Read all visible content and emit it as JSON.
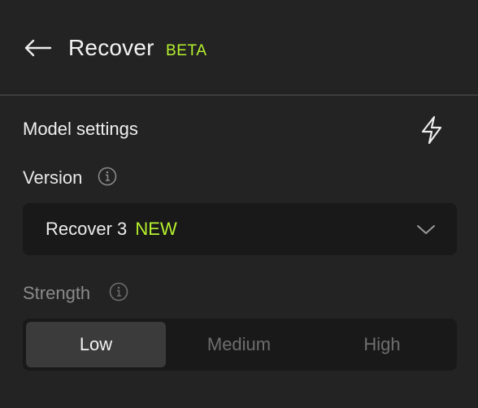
{
  "header": {
    "title": "Recover",
    "badge": "BETA",
    "icons": {
      "back": "arrow-left-icon"
    }
  },
  "model_settings": {
    "title": "Model settings",
    "icons": {
      "action": "lightning-bolt-icon"
    },
    "version": {
      "label": "Version",
      "info_icon": "info-icon",
      "selected_value": "Recover 3",
      "selected_badge": "NEW",
      "dropdown_icon": "chevron-down-icon"
    },
    "strength": {
      "label": "Strength",
      "info_icon": "info-icon",
      "options": [
        "Low",
        "Medium",
        "High"
      ],
      "selected": "Low"
    }
  },
  "colors": {
    "background": "#232323",
    "field_background": "#191919",
    "accent": "#b6f22e",
    "selected_segment": "#3b3b3b",
    "muted_text": "#6e6e6e",
    "divider": "#3c3c3c"
  }
}
